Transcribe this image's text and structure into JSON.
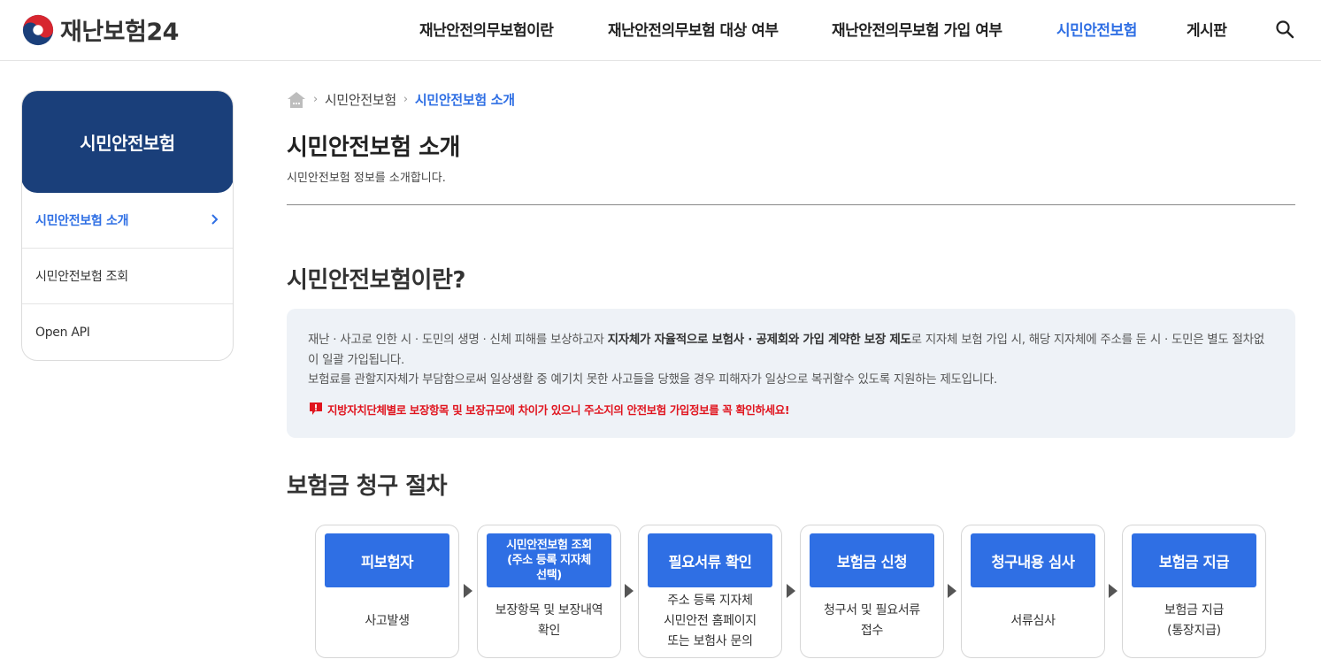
{
  "header": {
    "logo_text": "재난보험24",
    "nav": [
      {
        "label": "재난안전의무보험이란"
      },
      {
        "label": "재난안전의무보험 대상 여부"
      },
      {
        "label": "재난안전의무보험 가입 여부"
      },
      {
        "label": "시민안전보험",
        "active": true
      },
      {
        "label": "게시판"
      }
    ],
    "search_icon": "search-icon"
  },
  "sidebar": {
    "title": "시민안전보험",
    "items": [
      {
        "label": "시민안전보험 소개",
        "active": true
      },
      {
        "label": "시민안전보험 조회"
      },
      {
        "label": "Open API"
      }
    ]
  },
  "breadcrumb": {
    "home_icon": "home-icon",
    "items": [
      "시민안전보험",
      "시민안전보험 소개"
    ]
  },
  "page": {
    "title": "시민안전보험 소개",
    "subtitle": "시민안전보험 정보를 소개합니다."
  },
  "intro": {
    "title": "시민안전보험이란?",
    "line1_pre": "재난 · 사고로 인한 시 · 도민의 생명 · 신체 피해를 보상하고자 ",
    "line1_bold": "지자체가 자율적으로 보험사 · 공제회와 가입 계약한 보장 제도",
    "line1_post": "로 지자체 보험 가입 시, 해당 지자체에 주소를 둔 시 · 도민은 별도 절차없이 일괄 가입됩니다.",
    "line2": "보험료를 관할지자체가 부담함으로써 일상생활 중 예기치 못한 사고들을 당했을 경우 피해자가 일상으로 복귀할수 있도록 지원하는 제도입니다.",
    "warning": "지방자치단체별로 보장항목 및 보장규모에 차이가 있으니 주소지의 안전보험 가입정보를 꼭 확인하세요!"
  },
  "claim": {
    "title": "보험금 청구 절차",
    "steps": [
      {
        "title": "피보험자",
        "desc": "사고발생"
      },
      {
        "title": "시민안전보험 조회\n(주소 등록 지자체\n선택)",
        "desc": "보장항목 및 보장내역\n확인"
      },
      {
        "title": "필요서류 확인",
        "desc": "주소 등록 지자체\n시민안전 홈페이지\n또는 보험사 문의"
      },
      {
        "title": "보험금 신청",
        "desc": "청구서 및 필요서류\n접수"
      },
      {
        "title": "청구내용 심사",
        "desc": "서류심사"
      },
      {
        "title": "보험금 지급",
        "desc": "보험금 지급\n(통장지급)"
      }
    ]
  },
  "colors": {
    "accent": "#2f6fe4",
    "sidebar_header": "#1a3f7a",
    "warning": "#e0141e",
    "info_bg": "#eef2f7"
  }
}
